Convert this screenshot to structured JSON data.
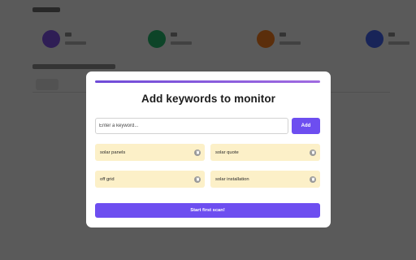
{
  "modal": {
    "title": "Add keywords to monitor",
    "progress_fraction": 1.0,
    "input": {
      "placeholder": "Enter a keyword...",
      "value": ""
    },
    "add_label": "Add",
    "keywords": [
      {
        "label": "solar panels"
      },
      {
        "label": "solar quote"
      },
      {
        "label": "off grid"
      },
      {
        "label": "solar installation"
      }
    ],
    "start_label": "Start first scan!"
  },
  "colors": {
    "accent": "#6d4ef0",
    "chip_bg": "#fcf0c8",
    "progress_start": "#6f4bd8",
    "progress_end": "#a06be0"
  },
  "icons": {
    "chip_remove": "trash-icon"
  }
}
